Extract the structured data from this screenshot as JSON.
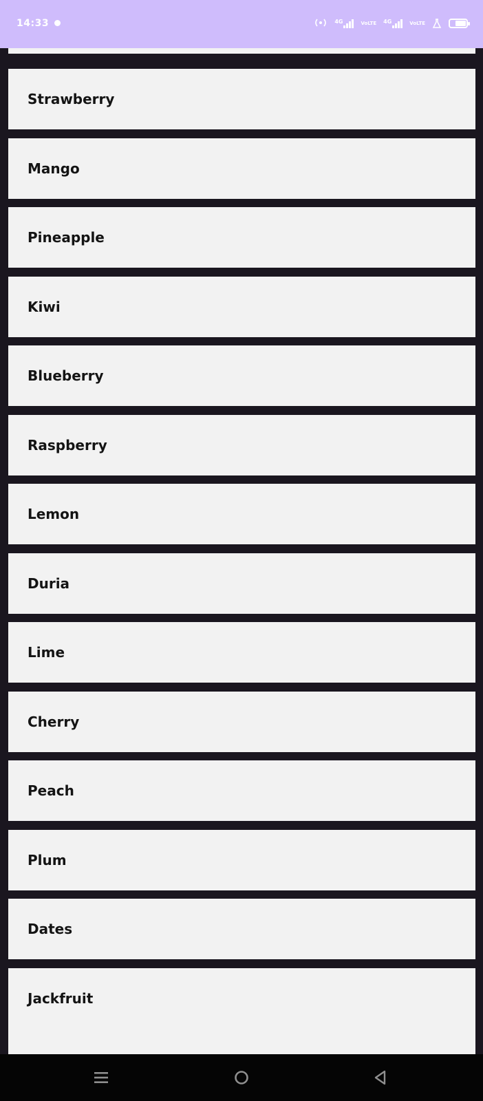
{
  "status_bar": {
    "time": "14:33",
    "network_a": "4G",
    "network_b": "VoLTE",
    "network_c": "4G",
    "network_d": "VoLTE",
    "battery_level": "68",
    "background_color": "#cfbcfc"
  },
  "list": {
    "items": [
      {
        "label": "Strawberry"
      },
      {
        "label": "Mango"
      },
      {
        "label": "Pineapple"
      },
      {
        "label": "Kiwi"
      },
      {
        "label": "Blueberry"
      },
      {
        "label": "Raspberry"
      },
      {
        "label": "Lemon"
      },
      {
        "label": "Duria"
      },
      {
        "label": "Lime"
      },
      {
        "label": "Cherry"
      },
      {
        "label": "Peach"
      },
      {
        "label": "Plum"
      },
      {
        "label": "Dates"
      },
      {
        "label": "Jackfruit"
      }
    ],
    "card_color": "#f2f2f2",
    "background_color": "#1a161f"
  },
  "nav_bar": {
    "recents_icon": "menu-icon",
    "home_icon": "circle-icon",
    "back_icon": "triangle-back-icon"
  }
}
